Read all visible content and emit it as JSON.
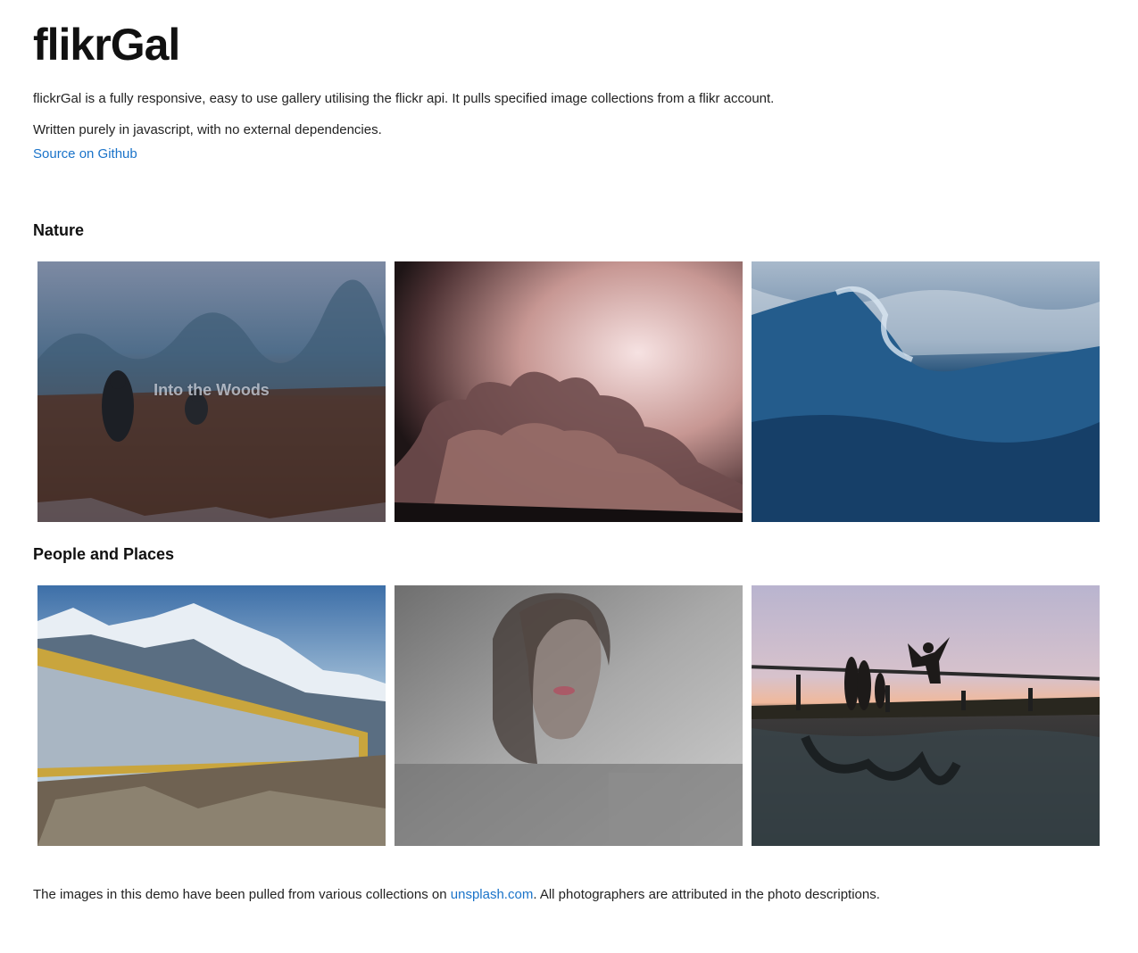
{
  "header": {
    "title": "flikrGal",
    "intro_1": "flickrGal is a fully responsive, easy to use gallery utilising the flickr api. It pulls specified image collections from a flikr account.",
    "intro_2": "Written purely in javascript, with no external dependencies.",
    "source_link": "Source on Github"
  },
  "collections": [
    {
      "title": "Nature",
      "photos": [
        {
          "alt": "foggy field with two figures",
          "caption": "Into the Woods"
        },
        {
          "alt": "pink storm clouds"
        },
        {
          "alt": "blue ocean wave"
        }
      ]
    },
    {
      "title": "People and Places",
      "photos": [
        {
          "alt": "freight train beneath mountains"
        },
        {
          "alt": "woman behind rainy window"
        },
        {
          "alt": "friends jumping off pier at sunset"
        }
      ]
    }
  ],
  "footer": {
    "text_before": "The images in this demo have been pulled from various collections on ",
    "link": "unsplash.com",
    "text_after": ". All photographers are attributed in the photo descriptions."
  },
  "colors": {
    "link": "#1a73c9",
    "text": "#111111"
  }
}
